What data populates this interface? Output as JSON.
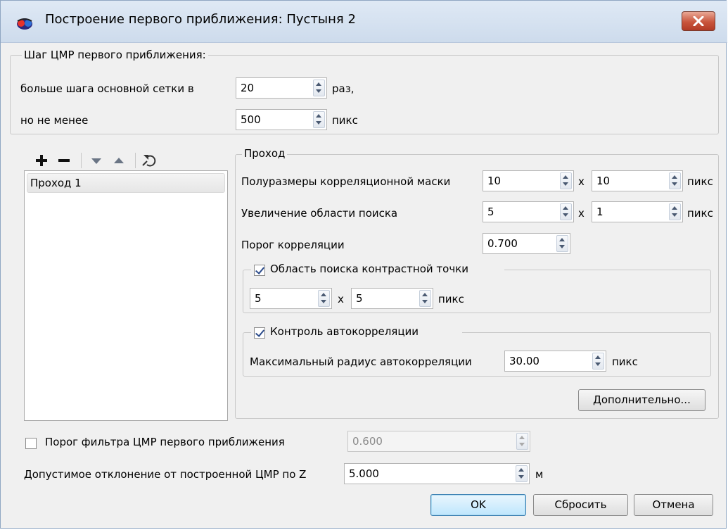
{
  "window": {
    "title": "Построение первого приближения: Пустыня 2",
    "icon": "app-icon",
    "close_icon": "close-icon"
  },
  "dem_step": {
    "group_title": "Шаг ЦМР первого приближения:",
    "more_than_label": "больше шага основной сетки в",
    "more_than_value": "20",
    "more_than_unit": "раз,",
    "not_less_label": "но не менее",
    "not_less_value": "500",
    "not_less_unit": "пикс"
  },
  "toolbar": {
    "icons": [
      "add-icon",
      "remove-icon",
      "move-down-icon",
      "move-up-icon",
      "reset-icon"
    ]
  },
  "pass_list": {
    "items": [
      "Проход 1"
    ]
  },
  "pass": {
    "group_title": "Проход",
    "mask_label": "Полуразмеры корреляционной маски",
    "mask_x": "10",
    "mask_y": "10",
    "search_label": "Увеличение области поиска",
    "search_x": "5",
    "search_y": "1",
    "threshold_label": "Порог корреляции",
    "threshold_value": "0.700",
    "times": "x",
    "unit": "пикс",
    "contrast": {
      "title": "Область поиска контрастной точки",
      "checked": true,
      "x": "5",
      "y": "5",
      "times": "x",
      "unit": "пикс"
    },
    "autocorr": {
      "title": "Контроль автокорреляции",
      "checked": true,
      "radius_label": "Максимальный радиус автокорреляции",
      "radius_value": "30.00",
      "unit": "пикс"
    },
    "advanced_button": "Дополнительно..."
  },
  "filter": {
    "label": "Порог фильтра ЦМР первого приближения",
    "checked": false,
    "value": "0.600"
  },
  "deviation": {
    "label": "Допустимое отклонение от построенной ЦМР по Z",
    "value": "5.000",
    "unit": "м"
  },
  "buttons": {
    "ok": "OK",
    "reset": "Сбросить",
    "cancel": "Отмена"
  }
}
